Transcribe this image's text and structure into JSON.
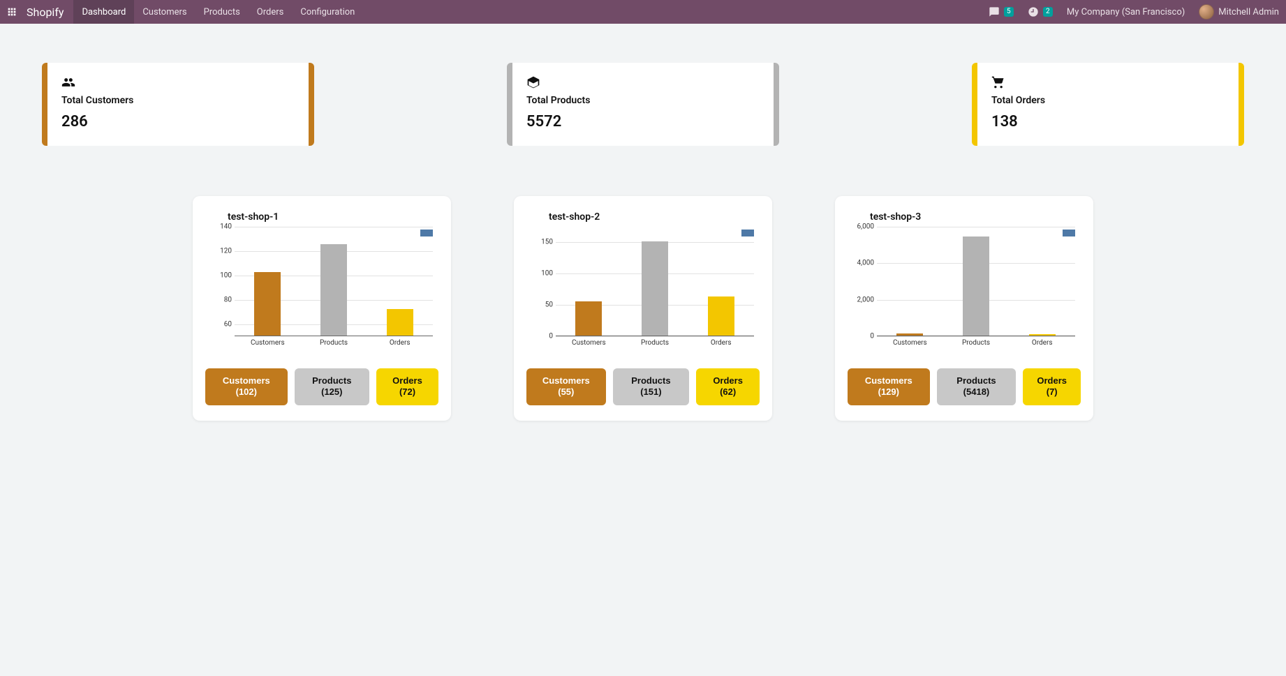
{
  "topbar": {
    "brand": "Shopify",
    "menu": [
      "Dashboard",
      "Customers",
      "Products",
      "Orders",
      "Configuration"
    ],
    "active_menu": 0,
    "chat_badge": "5",
    "clock_badge": "2",
    "company": "My Company (San Francisco)",
    "user": "Mitchell Admin"
  },
  "summary": [
    {
      "icon": "users-icon",
      "title": "Total Customers",
      "value": "286",
      "edge": "brown"
    },
    {
      "icon": "box-icon",
      "title": "Total Products",
      "value": "5572",
      "edge": "grey"
    },
    {
      "icon": "cart-icon",
      "title": "Total Orders",
      "value": "138",
      "edge": "yellow"
    }
  ],
  "colors": {
    "brown": "#c07a1d",
    "grey": "#b3b3b3",
    "yellow": "#f3c600"
  },
  "chart_data": [
    {
      "type": "bar",
      "title": "test-shop-1",
      "categories": [
        "Customers",
        "Products",
        "Orders"
      ],
      "values": [
        102,
        125,
        72
      ],
      "ylim": [
        50,
        140
      ],
      "yticks": [
        60,
        80,
        100,
        120,
        140
      ],
      "colors": [
        "brown",
        "grey",
        "yellow"
      ],
      "buttons": [
        "Customers (102)",
        "Products (125)",
        "Orders (72)"
      ]
    },
    {
      "type": "bar",
      "title": "test-shop-2",
      "categories": [
        "Customers",
        "Products",
        "Orders"
      ],
      "values": [
        55,
        151,
        62
      ],
      "ylim": [
        0,
        175
      ],
      "yticks": [
        0,
        50,
        100,
        150
      ],
      "colors": [
        "brown",
        "grey",
        "yellow"
      ],
      "buttons": [
        "Customers (55)",
        "Products (151)",
        "Orders (62)"
      ]
    },
    {
      "type": "bar",
      "title": "test-shop-3",
      "categories": [
        "Customers",
        "Products",
        "Orders"
      ],
      "values": [
        129,
        5418,
        7
      ],
      "ylim": [
        0,
        6000
      ],
      "yticks": [
        0,
        2000,
        4000,
        6000
      ],
      "ytick_labels": [
        "0",
        "2,000",
        "4,000",
        "6,000"
      ],
      "colors": [
        "brown",
        "grey",
        "yellow"
      ],
      "buttons": [
        "Customers (129)",
        "Products (5418)",
        "Orders (7)"
      ]
    }
  ]
}
